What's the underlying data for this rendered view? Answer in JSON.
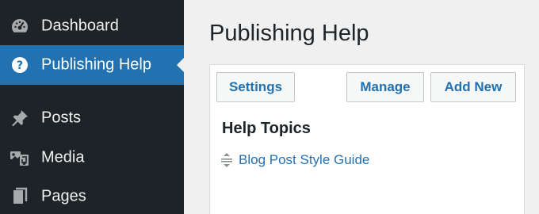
{
  "sidebar": {
    "items": [
      {
        "label": "Dashboard",
        "icon": "dashboard-icon"
      },
      {
        "label": "Publishing Help",
        "icon": "help-icon",
        "active": true
      },
      {
        "label": "Posts",
        "icon": "pushpin-icon"
      },
      {
        "label": "Media",
        "icon": "media-icon"
      },
      {
        "label": "Pages",
        "icon": "pages-icon"
      }
    ]
  },
  "main": {
    "title": "Publishing Help",
    "toolbar": {
      "settings_label": "Settings",
      "manage_label": "Manage",
      "add_new_label": "Add New"
    },
    "help_topics": {
      "heading": "Help Topics",
      "items": [
        {
          "label": "Blog Post Style Guide",
          "icon": "drag-handle-icon"
        }
      ]
    }
  },
  "colors": {
    "sidebar_bg": "#1d2327",
    "active_bg": "#2271b1",
    "link": "#2271b1",
    "page_bg": "#f0f0f1"
  }
}
